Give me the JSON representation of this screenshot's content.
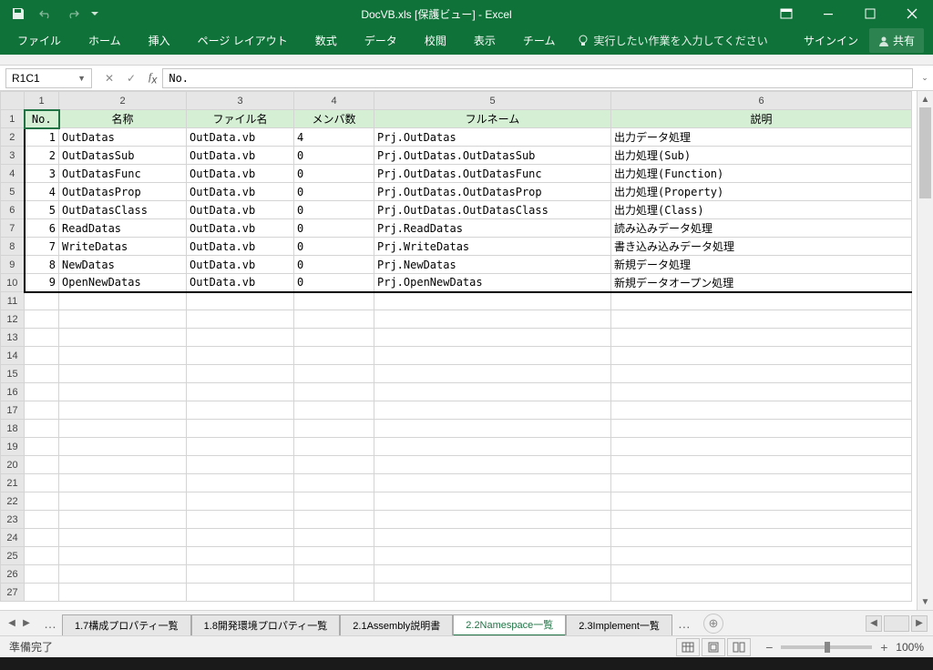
{
  "window": {
    "title": "DocVB.xls  [保護ビュー] - Excel"
  },
  "ribbon": {
    "tabs": [
      "ファイル",
      "ホーム",
      "挿入",
      "ページ レイアウト",
      "数式",
      "データ",
      "校閲",
      "表示",
      "チーム"
    ],
    "tellme": "実行したい作業を入力してください",
    "signin": "サインイン",
    "share": "共有"
  },
  "formulabar": {
    "namebox": "R1C1",
    "value": "No."
  },
  "columns": [
    "1",
    "2",
    "3",
    "4",
    "5",
    "6"
  ],
  "headers": [
    "No.",
    "名称",
    "ファイル名",
    "メンバ数",
    "フルネーム",
    "説明"
  ],
  "rows": [
    {
      "no": "1",
      "name": "OutDatas",
      "file": "OutData.vb",
      "members": "4",
      "full": "Prj.OutDatas",
      "desc": "出力データ処理"
    },
    {
      "no": "2",
      "name": "OutDatasSub",
      "file": "OutData.vb",
      "members": "0",
      "full": "Prj.OutDatas.OutDatasSub",
      "desc": "出力処理(Sub)"
    },
    {
      "no": "3",
      "name": "OutDatasFunc",
      "file": "OutData.vb",
      "members": "0",
      "full": "Prj.OutDatas.OutDatasFunc",
      "desc": "出力処理(Function)"
    },
    {
      "no": "4",
      "name": "OutDatasProp",
      "file": "OutData.vb",
      "members": "0",
      "full": "Prj.OutDatas.OutDatasProp",
      "desc": "出力処理(Property)"
    },
    {
      "no": "5",
      "name": "OutDatasClass",
      "file": "OutData.vb",
      "members": "0",
      "full": "Prj.OutDatas.OutDatasClass",
      "desc": "出力処理(Class)"
    },
    {
      "no": "6",
      "name": "ReadDatas",
      "file": "OutData.vb",
      "members": "0",
      "full": "Prj.ReadDatas",
      "desc": "読み込みデータ処理"
    },
    {
      "no": "7",
      "name": "WriteDatas",
      "file": "OutData.vb",
      "members": "0",
      "full": "Prj.WriteDatas",
      "desc": "書き込み込みデータ処理"
    },
    {
      "no": "8",
      "name": "NewDatas",
      "file": "OutData.vb",
      "members": "0",
      "full": "Prj.NewDatas",
      "desc": "新規データ処理"
    },
    {
      "no": "9",
      "name": "OpenNewDatas",
      "file": "OutData.vb",
      "members": "0",
      "full": "Prj.OpenNewDatas",
      "desc": "新規データオープン処理"
    }
  ],
  "empty_row_count": 17,
  "sheets": {
    "tabs": [
      "1.7構成プロパティ一覧",
      "1.8開発環境プロパティ一覧",
      "2.1Assembly説明書",
      "2.2Namespace一覧",
      "2.3Implement一覧"
    ],
    "active_index": 3
  },
  "statusbar": {
    "ready": "準備完了",
    "zoom": "100%"
  }
}
